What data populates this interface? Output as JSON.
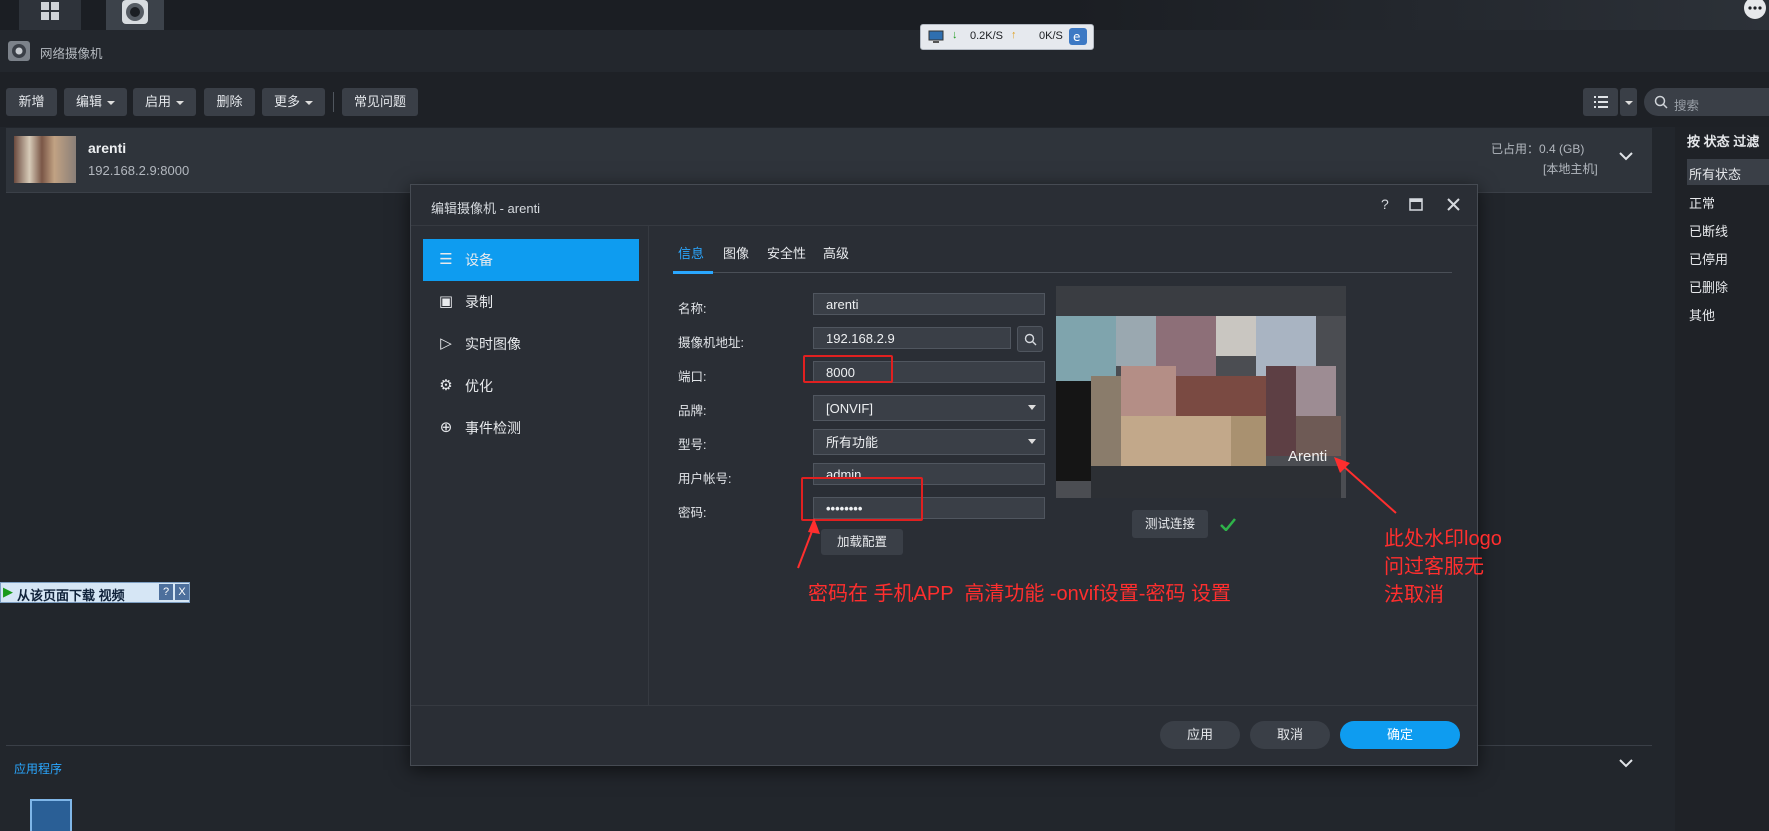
{
  "app": {
    "title": "网络摄像机"
  },
  "network": {
    "down": "0.2K/S",
    "up": "0K/S"
  },
  "toolbar": {
    "add": "新增",
    "edit": "编辑",
    "enable": "启用",
    "delete": "删除",
    "more": "更多",
    "faq": "常见问题",
    "search_placeholder": "搜索"
  },
  "camera": {
    "name": "arenti",
    "address": "192.168.2.9:8000",
    "used": "已占用：0.4 (GB)",
    "host": "[本地主机]"
  },
  "filter": {
    "title": "按 状态 过滤",
    "items": [
      "所有状态",
      "正常",
      "已断线",
      "已停用",
      "已删除",
      "其他"
    ]
  },
  "download_bar": {
    "label": "从该页面下载 视频",
    "help": "?",
    "close": "X"
  },
  "apps": {
    "label": "应用程序"
  },
  "dialog": {
    "title": "编辑摄像机 - arenti",
    "side": [
      "设备",
      "录制",
      "实时图像",
      "优化",
      "事件检测"
    ],
    "tabs": [
      "信息",
      "图像",
      "安全性",
      "高级"
    ],
    "fields": {
      "name_label": "名称:",
      "name_value": "arenti",
      "addr_label": "摄像机地址:",
      "addr_value": "192.168.2.9",
      "port_label": "端口:",
      "port_value": "8000",
      "brand_label": "品牌:",
      "brand_value": "[ONVIF]",
      "model_label": "型号:",
      "model_value": "所有功能",
      "user_label": "用户帐号:",
      "user_value": "admin",
      "pass_label": "密码:",
      "pass_value": "••••••••"
    },
    "load_config": "加载配置",
    "test_connection": "测试连接",
    "preview_watermark": "Arenti",
    "apply": "应用",
    "cancel": "取消",
    "ok": "确定"
  },
  "annotations": {
    "password_note": "密码在 手机APP  高清功能 -onvif设置-密码 设置",
    "watermark_note_1": "此处水印logo",
    "watermark_note_2": "问过客服无",
    "watermark_note_3": "法取消"
  }
}
